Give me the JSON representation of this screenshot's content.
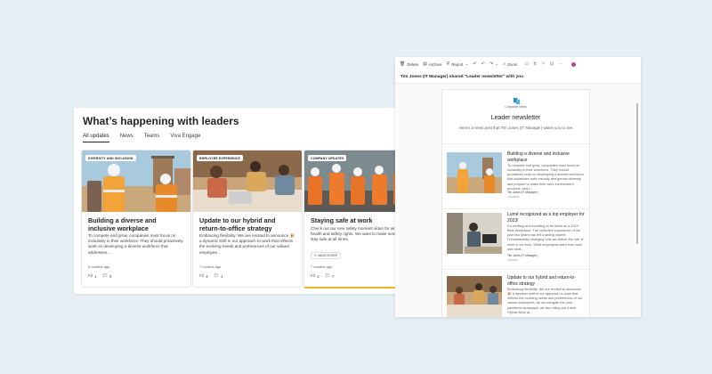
{
  "leaders": {
    "title": "What’s happening with leaders",
    "tabs": [
      "All updates",
      "News",
      "Teams",
      "Viva Engage"
    ],
    "cards": [
      {
        "category": "DIVERSITY AND INCLUSION",
        "title": "Building a diverse and inclusive workplace",
        "desc": "To compete and grow, companies must focus on inclusivity in their workforce. They should proactively work on developing a diverse workforce that addresses...",
        "time": "6 months ago",
        "likes": "1",
        "comments": "0"
      },
      {
        "category": "EMPLOYEE EXPERIENCE",
        "title": "Update to our hybrid and return-to-office strategy",
        "desc": "Embracing flexibility: We are excited to announce 🎉 a dynamic shift in our approach to work that reflects the evolving needs and preferences of our valued employee...",
        "time": "7 months ago",
        "likes": "4",
        "comments": "1"
      },
      {
        "category": "COMPANY UPDATES",
        "title": "Staying safe at work",
        "desc": "Check out our new safety moment video for worker health and safety rights. We want to make sure you stay safe at all times.",
        "location": "VANCOUVER",
        "time": "7 months ago",
        "likes": "2",
        "comments": "7"
      }
    ]
  },
  "mail": {
    "toolbar": [
      "Delete",
      "Archive",
      "Report",
      "Zoom"
    ],
    "subject": "Tim Jones (IT Manager) shared \"Leader newsletter\" with you",
    "newsletter": {
      "company": "Corporate News",
      "title": "Leader newsletter",
      "subtitle": "Here's a news post that Tim Jones (IT Manager) wants you to see",
      "items": [
        {
          "title": "Building a diverse and inclusive workplace",
          "desc": "To compete and grow, companies must focus on inclusivity in their workforce. They should proactively work on developing a diverse workforce that addresses both minority and gender diversity and prepare to make their work environment, products, and c...",
          "author": "Tim Jones (IT Manager)",
          "date": "7/21/2024"
        },
        {
          "title": "Lumé recognized as a top employer for 2023!",
          "desc": "It's exciting and humbling to be listed as a 2023 Best Workplace. The collective experience of the past two years has left a lasting imprint. Fundamentally changing how we deliver the role of work in our lives. What employees want from work and what...",
          "author": "Tim Jones (IT Manager)",
          "date": "7/9/2024"
        },
        {
          "title": "Update to our hybrid and return-to-office strategy",
          "desc": "Embracing flexibility: We are excited to announce 🎉 a dynamic shift in our approach to work that reflects the evolving needs and preferences of our valued employees. As we navigate the post-pandemic landscape, we are rolling out a new Hybrid Work ar...",
          "author": "",
          "date": ""
        }
      ]
    }
  }
}
